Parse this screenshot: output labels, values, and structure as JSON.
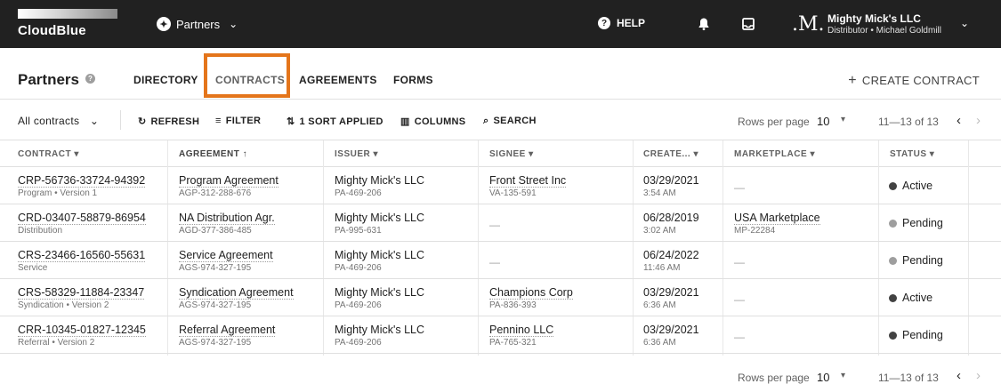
{
  "topbar": {
    "logo_text": "CloudBlue",
    "nav_label": "Partners",
    "help_label": "HELP",
    "account_name": "Mighty Mick's LLC",
    "account_sub": "Distributor • Michael Goldmill"
  },
  "header": {
    "title": "Partners",
    "tabs": [
      "DIRECTORY",
      "CONTRACTS",
      "AGREEMENTS",
      "FORMS"
    ],
    "active_tab": "CONTRACTS",
    "create_label": "CREATE CONTRACT"
  },
  "toolbar": {
    "filter_select": "All contracts",
    "refresh": "REFRESH",
    "filter": "FILTER",
    "sort": "1 SORT APPLIED",
    "columns": "COLUMNS",
    "search": "SEARCH",
    "rows_per_page_label": "Rows per page",
    "rows_per_page": "10",
    "range": "11—13 of 13"
  },
  "table": {
    "columns": [
      "CONTRACT",
      "AGREEMENT",
      "ISSUER",
      "SIGNEE",
      "CREATE...",
      "MARKETPLACE",
      "STATUS"
    ],
    "rows": [
      {
        "contract": "CRP-56736-33724-94392",
        "contract_sub": "Program • Version 1",
        "agreement": "Program Agreement",
        "agreement_sub": "AGP-312-288-676",
        "issuer": "Mighty Mick's LLC",
        "issuer_sub": "PA-469-206",
        "signee": "Front Street Inc",
        "signee_sub": "VA-135-591",
        "created": "03/29/2021",
        "created_sub": "3:54 AM",
        "marketplace": "",
        "marketplace_sub": "",
        "status": "Active"
      },
      {
        "contract": "CRD-03407-58879-86954",
        "contract_sub": "Distribution",
        "agreement": "NA Distribution Agr.",
        "agreement_sub": "AGD-377-386-485",
        "issuer": "Mighty Mick's LLC",
        "issuer_sub": "PA-995-631",
        "signee": "",
        "signee_sub": "",
        "created": "06/28/2019",
        "created_sub": "3:02 AM",
        "marketplace": "USA Marketplace",
        "marketplace_sub": "MP-22284",
        "status": "Pending"
      },
      {
        "contract": "CRS-23466-16560-55631",
        "contract_sub": "Service",
        "agreement": "Service Agreement",
        "agreement_sub": "AGS-974-327-195",
        "issuer": "Mighty Mick's LLC",
        "issuer_sub": "PA-469-206",
        "signee": "",
        "signee_sub": "",
        "created": "06/24/2022",
        "created_sub": "11:46 AM",
        "marketplace": "",
        "marketplace_sub": "",
        "status": "Pending"
      },
      {
        "contract": "CRS-58329-11884-23347",
        "contract_sub": "Syndication • Version 2",
        "agreement": "Syndication Agreement",
        "agreement_sub": "AGS-974-327-195",
        "issuer": "Mighty Mick's LLC",
        "issuer_sub": "PA-469-206",
        "signee": "Champions Corp",
        "signee_sub": "PA-836-393",
        "created": "03/29/2021",
        "created_sub": "6:36 AM",
        "marketplace": "",
        "marketplace_sub": "",
        "status": "Active"
      },
      {
        "contract": "CRR-10345-01827-12345",
        "contract_sub": "Referral • Version 2",
        "agreement": "Referral Agreement",
        "agreement_sub": "AGS-974-327-195",
        "issuer": "Mighty Mick's LLC",
        "issuer_sub": "PA-469-206",
        "signee": "Pennino LLC",
        "signee_sub": "PA-765-321",
        "created": "03/29/2021",
        "created_sub": "6:36 AM",
        "marketplace": "",
        "marketplace_sub": "",
        "status": "Pending"
      }
    ]
  },
  "footer": {
    "rows_per_page_label": "Rows per page",
    "rows_per_page": "10",
    "range": "11—13 of 13"
  },
  "colors": {
    "topbar_bg": "#212121",
    "highlight": "#e4751b",
    "status_active": "#424242",
    "status_pending": "#9e9e9e"
  },
  "icons": {
    "nav": "globe-icon",
    "help": "help-icon",
    "notifications": "bell-icon",
    "inbox": "inbox-icon",
    "refresh": "refresh-icon",
    "filter": "filter-icon",
    "sort": "sort-icon",
    "columns": "columns-icon",
    "search": "search-icon",
    "prev": "chevron-left-icon",
    "next": "chevron-right-icon"
  }
}
